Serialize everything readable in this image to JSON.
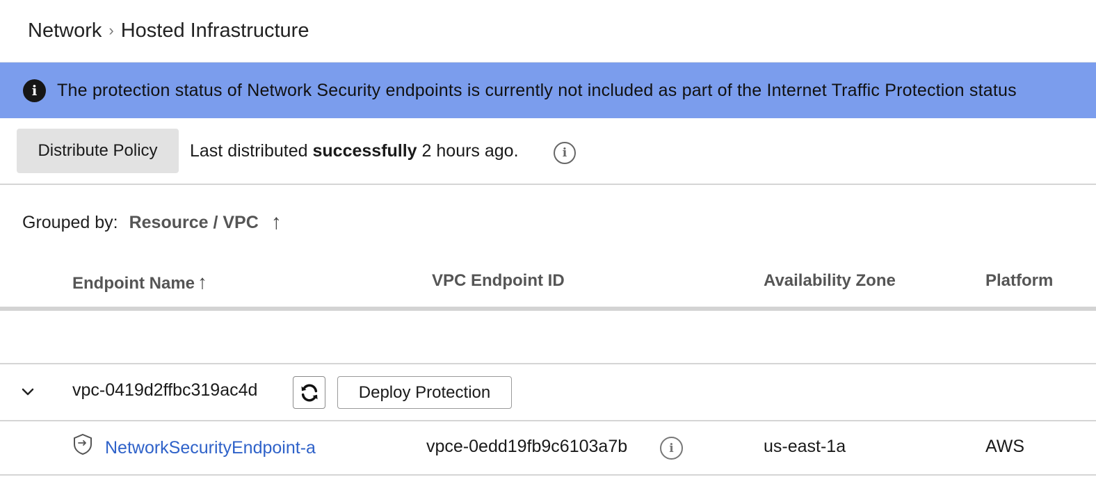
{
  "breadcrumb": {
    "parent": "Network",
    "separator": "›",
    "current": "Hosted Infrastructure"
  },
  "banner": {
    "icon": "info-icon",
    "text": "The protection status of Network Security endpoints is currently not included as part of the Internet Traffic Protection status",
    "color": "#7b9ded"
  },
  "toolbar": {
    "distribute_label": "Distribute Policy",
    "status_prefix": "Last distributed ",
    "status_bold": "successfully",
    "status_suffix": " 2 hours ago."
  },
  "grouping": {
    "label": "Grouped by:",
    "value": "Resource / VPC",
    "sort_icon": "arrow-up-icon"
  },
  "table": {
    "columns": [
      "Endpoint Name",
      "VPC Endpoint ID",
      "Availability Zone",
      "Platform"
    ],
    "sort_column": "Endpoint Name",
    "groups": [
      {
        "vpc_id": "vpc-0419d2ffbc319ac4d",
        "deploy_label": "Deploy Protection",
        "rows": [
          {
            "name": "NetworkSecurityEndpoint-a",
            "vpce_id": "vpce-0edd19fb9c6103a7b",
            "az": "us-east-1a",
            "platform": "AWS"
          }
        ]
      }
    ]
  },
  "colors": {
    "link": "#2f62c9",
    "banner": "#7b9ded"
  }
}
